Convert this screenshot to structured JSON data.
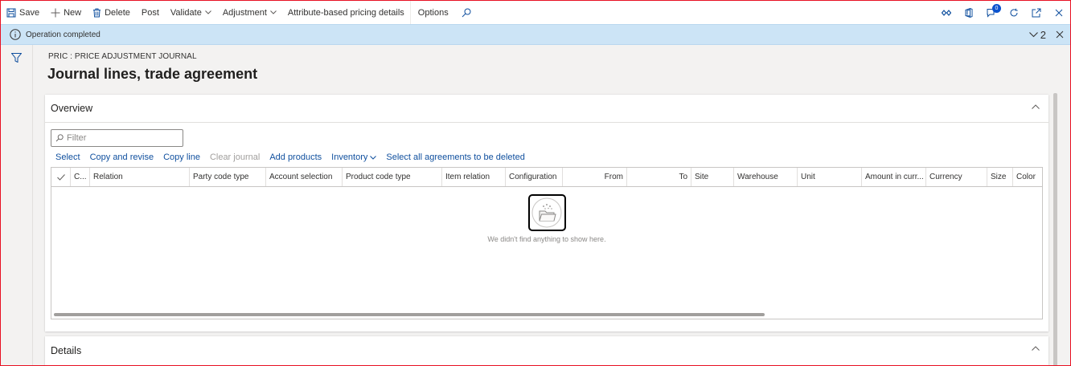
{
  "actionbar": {
    "save": "Save",
    "new": "New",
    "delete": "Delete",
    "post": "Post",
    "validate": "Validate",
    "adjustment": "Adjustment",
    "attribute_pricing": "Attribute-based pricing details",
    "options": "Options",
    "notification_count": "0"
  },
  "message": {
    "text": "Operation completed",
    "count": "2"
  },
  "page": {
    "breadcrumb": "PRIC : PRICE ADJUSTMENT JOURNAL",
    "title": "Journal lines, trade agreement"
  },
  "overview": {
    "title": "Overview",
    "filter_placeholder": "Filter",
    "actions": {
      "select": "Select",
      "copy_and_revise": "Copy and revise",
      "copy_line": "Copy line",
      "clear_journal": "Clear journal",
      "add_products": "Add products",
      "inventory": "Inventory",
      "select_all_delete": "Select all agreements to be deleted"
    },
    "columns": [
      "C...",
      "Relation",
      "Party code type",
      "Account selection",
      "Product code type",
      "Item relation",
      "Configuration",
      "From",
      "To",
      "Site",
      "Warehouse",
      "Unit",
      "Amount in curr...",
      "Currency",
      "Size",
      "Color"
    ],
    "empty_text": "We didn't find anything to show here."
  },
  "details": {
    "title": "Details"
  },
  "colors": {
    "accent": "#0f4f9e",
    "message_bg": "#cce4f6",
    "badge": "#0b53ce",
    "frame": "#e81123"
  }
}
